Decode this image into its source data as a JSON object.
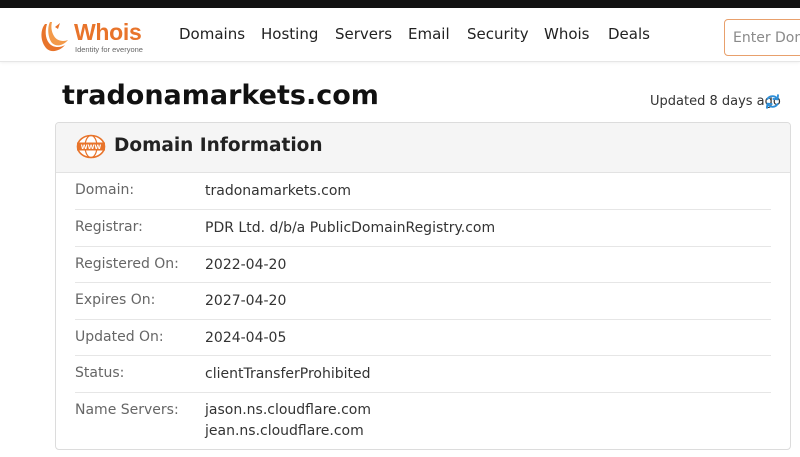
{
  "brand": {
    "name": "Whois",
    "tagline": "Identity for everyone",
    "color": "#e8742b"
  },
  "nav": {
    "items": [
      "Domains",
      "Hosting",
      "Servers",
      "Email",
      "Security",
      "Whois",
      "Deals"
    ],
    "search_placeholder": "Enter Domain"
  },
  "page": {
    "domain": "tradonamarkets.com",
    "updated": "Updated 8 days ago",
    "refresh_icon": "refresh-icon"
  },
  "card": {
    "title": "Domain Information",
    "icon": "www-icon",
    "rows": [
      {
        "label": "Domain:",
        "value": "tradonamarkets.com"
      },
      {
        "label": "Registrar:",
        "value": "PDR Ltd. d/b/a PublicDomainRegistry.com"
      },
      {
        "label": "Registered On:",
        "value": "2022-04-20"
      },
      {
        "label": "Expires On:",
        "value": "2027-04-20"
      },
      {
        "label": "Updated On:",
        "value": "2024-04-05"
      },
      {
        "label": "Status:",
        "value": "clientTransferProhibited"
      },
      {
        "label": "Name Servers:",
        "values": [
          "jason.ns.cloudflare.com",
          "jean.ns.cloudflare.com"
        ]
      }
    ]
  }
}
